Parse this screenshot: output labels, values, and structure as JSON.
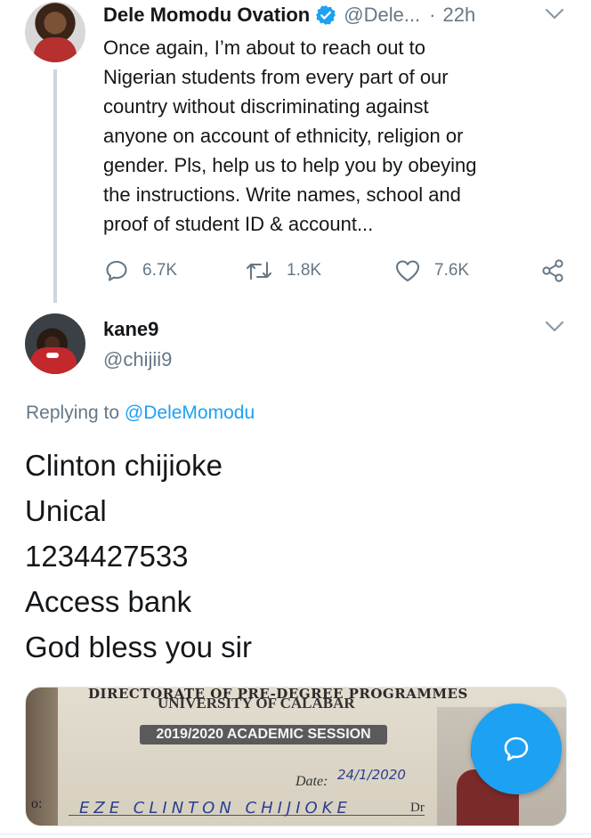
{
  "parent_tweet": {
    "display_name": "Dele Momodu Ovation",
    "handle": "@Dele...",
    "separator": "·",
    "time": "22h",
    "lines": [
      "Once again, I’m about to reach out to",
      "Nigerian students from every part of our",
      "country without discriminating against",
      "anyone on account of ethnicity, religion or",
      "gender. Pls, help us to help you by obeying",
      "the instructions. Write names, school and",
      "proof of student ID & account..."
    ],
    "replies": "6.7K",
    "retweets": "1.8K",
    "likes": "7.6K"
  },
  "reply_tweet": {
    "display_name": "kane9",
    "handle": "@chijii9",
    "replying_prefix": "Replying to",
    "replying_to": "@DeleMomodu",
    "lines": [
      "Clinton chijioke",
      "Unical",
      "1234427533",
      "Access bank",
      "God bless you sir"
    ]
  },
  "id_card": {
    "header": "DIRECTORATE OF PRE-DEGREE PROGRAMMES",
    "university": "UNIVERSITY OF CALABAR",
    "session": "2019/2020 ACADEMIC SESSION",
    "date_label": "Date:",
    "date_value": "24/1/2020",
    "name_handwritten": "EZE CLINTON CHIJIOKE",
    "no_label": "o:",
    "dr_mark": "Dr"
  },
  "colors": {
    "accent": "#1da1f2",
    "muted": "#657786",
    "text": "#14171a",
    "thread_line": "#ccd6dd"
  },
  "icons": [
    "verified-badge-icon",
    "chevron-down-icon",
    "reply-icon",
    "retweet-icon",
    "like-icon",
    "share-icon",
    "compose-icon"
  ]
}
